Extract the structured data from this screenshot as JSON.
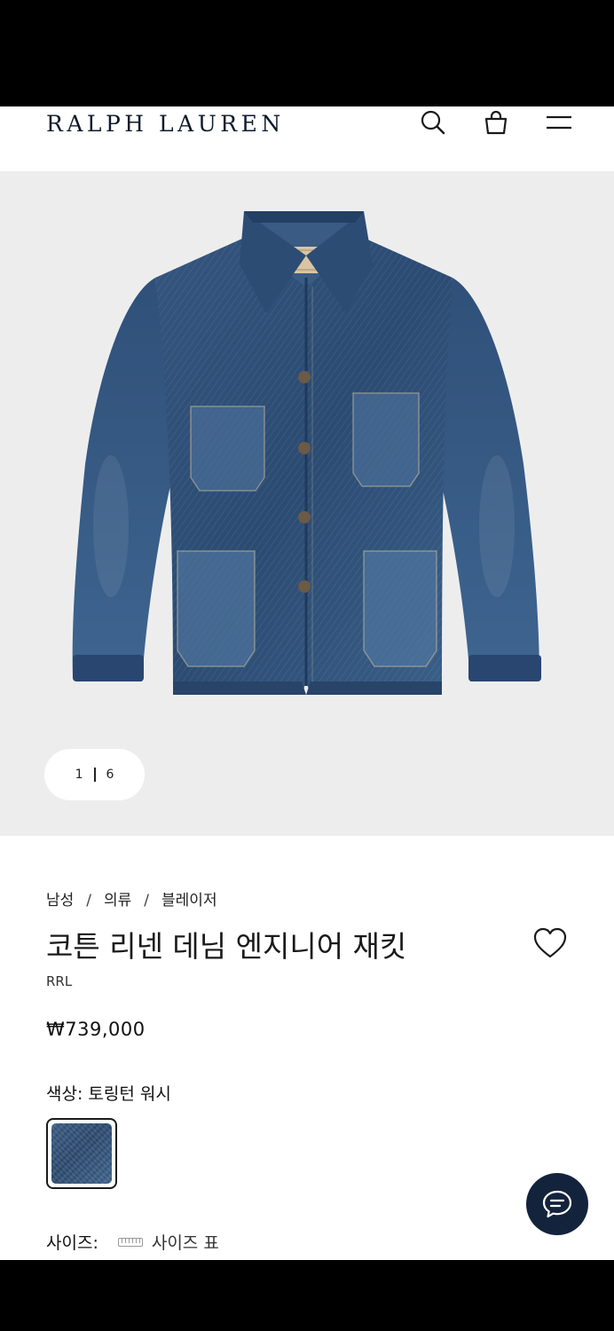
{
  "header": {
    "logo": "RALPH LAUREN",
    "icons": [
      "search-icon",
      "shopping-bag-icon",
      "menu-icon"
    ]
  },
  "gallery": {
    "current_page": "1",
    "total_pages": "6",
    "background_color": "#eeedee"
  },
  "breadcrumb": [
    "남성",
    "의류",
    "블레이저"
  ],
  "breadcrumb_separator": "/",
  "product": {
    "title": "코튼 리넨 데님 엔지니어 재킷",
    "brand": "RRL",
    "price": "₩739,000",
    "color_label": "색상:",
    "color_value": "토링턴 워시",
    "size_label": "사이즈:",
    "size_guide_label": "사이즈 표"
  },
  "colors": {
    "accent": "#14233c",
    "denim": "#2f5078"
  }
}
